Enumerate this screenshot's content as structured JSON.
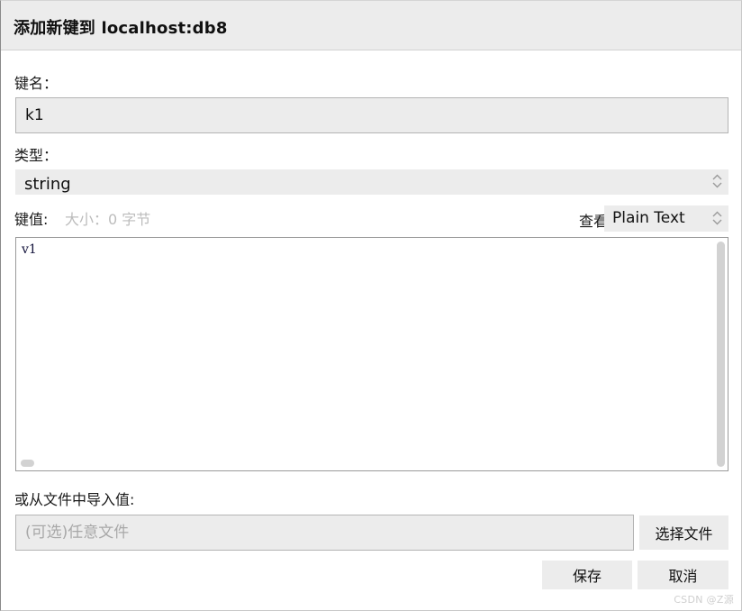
{
  "dialog": {
    "title": "添加新键到 localhost:db8"
  },
  "key_name": {
    "label": "键名：",
    "value": "k1"
  },
  "type": {
    "label": "类型：",
    "value": "string",
    "stepper_icon": "chevron-up-down-icon"
  },
  "key_value": {
    "label": "键值:",
    "size_text": "大小：0 字节",
    "view_label": "查看",
    "view_value": "Plain Text",
    "stepper_icon": "chevron-up-down-icon",
    "content": "v1"
  },
  "file_import": {
    "label": "或从文件中导入值:",
    "placeholder": "(可选)任意文件",
    "path_value": "",
    "choose_button": "选择文件"
  },
  "actions": {
    "save": "保存",
    "cancel": "取消"
  },
  "watermark": "CSDN @Z源",
  "colors": {
    "header_bg": "#ececec",
    "body_bg": "#ffffff",
    "input_bg": "#ececec",
    "input_border": "#b4b4b4",
    "text": "#1a1a1a",
    "muted_text": "#bcbcbc",
    "placeholder": "#a8a8a8",
    "scrollbar": "#d2d2d2"
  }
}
